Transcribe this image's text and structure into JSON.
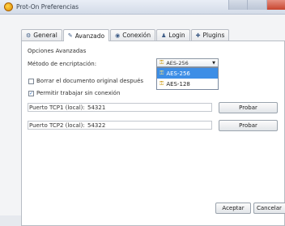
{
  "window": {
    "title": "Prot-On Preferencias"
  },
  "tabs": [
    {
      "label": "General",
      "icon": "gear-icon"
    },
    {
      "label": "Avanzado",
      "icon": "wrench-icon"
    },
    {
      "label": "Conexión",
      "icon": "globe-icon"
    },
    {
      "label": "Login",
      "icon": "user-icon"
    },
    {
      "label": "Plugins",
      "icon": "puzzle-icon"
    }
  ],
  "advanced": {
    "section_title": "Opciones Avanzadas",
    "encryption_label": "Método de encriptación:",
    "encryption_selected": "AES-256",
    "encryption_options": [
      "AES-256",
      "AES-128"
    ],
    "delete_original_label": "Borrar el documento original después",
    "delete_original_checked": false,
    "offline_label": "Permitir trabajar sin conexión",
    "offline_checked": true,
    "port1_label": "Puerto TCP1 (local):",
    "port1_value": "54321",
    "port2_label": "Puerto TCP2 (local):",
    "port2_value": "54322",
    "test_button": "Probar"
  },
  "footer": {
    "accept": "Aceptar",
    "cancel": "Cancelar"
  },
  "colors": {
    "selection": "#3d8ee6",
    "titlebar": "#d3dbe8"
  }
}
